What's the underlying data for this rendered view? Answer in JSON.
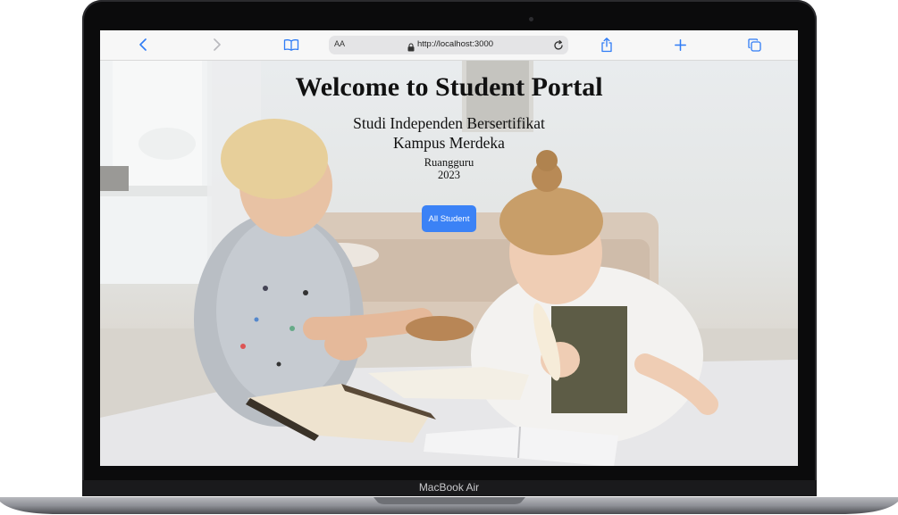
{
  "device": {
    "model_label": "MacBook Air"
  },
  "browser": {
    "text_size_label": "AA",
    "url": "http://localhost:3000",
    "icons": {
      "back": "chevron-left-icon",
      "forward": "chevron-right-icon",
      "bookmarks": "book-icon",
      "secure": "lock-icon",
      "reload": "reload-icon",
      "share": "share-icon",
      "new_tab": "plus-icon",
      "tabs": "tabs-icon"
    },
    "accent_color": "#2f7cf6"
  },
  "hero": {
    "title": "Welcome to Student Portal",
    "subtitle_line1": "Studi Independen Bersertifikat",
    "subtitle_line2": "Kampus Merdeka",
    "org": "Ruangguru",
    "year": "2023",
    "button_label": "All Student",
    "button_color": "#3b82f6",
    "background_image": "two children reading books at a table"
  }
}
